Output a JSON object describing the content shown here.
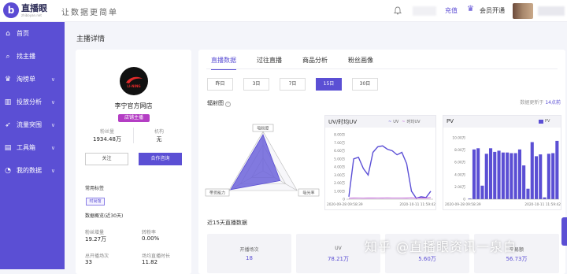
{
  "brand": {
    "logo_letter": "b",
    "name": "直播眼",
    "sub": "zhiboyan.net",
    "slogan": "让数据更简单"
  },
  "topbar": {
    "recharge": "充值",
    "member": "会员开通"
  },
  "sidebar": {
    "items": [
      {
        "label": "首页",
        "icon": "home-icon",
        "glyph": "⌂",
        "arrow": ""
      },
      {
        "label": "找主播",
        "icon": "search-icon",
        "glyph": "⌕",
        "arrow": ""
      },
      {
        "label": "淘榜单",
        "icon": "trophy-icon",
        "glyph": "♛",
        "arrow": "∨"
      },
      {
        "label": "投放分析",
        "icon": "bar-chart-icon",
        "glyph": "▥",
        "arrow": "∨"
      },
      {
        "label": "流量突围",
        "icon": "rocket-icon",
        "glyph": "➶",
        "arrow": "∨"
      },
      {
        "label": "工具箱",
        "icon": "toolbox-icon",
        "glyph": "▤",
        "arrow": "∨"
      },
      {
        "label": "我的数据",
        "icon": "pie-icon",
        "glyph": "◔",
        "arrow": "∨"
      }
    ]
  },
  "page_title": "主播详情",
  "profile": {
    "logo_text": "LI-NING",
    "name": "李宁官方网店",
    "tag": "店铺主播",
    "fans_label": "粉丝量",
    "fans_value": "1934.48万",
    "org_label": "机构",
    "org_value": "无",
    "follow": "关注",
    "consult": "合作咨询",
    "common_tags_title": "常用标签",
    "time_tag": "时尚馆",
    "overview_title": "数据概览(近30天)",
    "overview": [
      {
        "label": "粉丝增量",
        "value": "19.27万"
      },
      {
        "label": "转粉率",
        "value": "0.00%"
      },
      {
        "label": "总开播场次",
        "value": "33"
      },
      {
        "label": "场均直播时长",
        "value": "11.82"
      }
    ]
  },
  "tabs": [
    "直播数据",
    "过往直播",
    "商品分析",
    "粉丝画像"
  ],
  "ranges": [
    "昨日",
    "3日",
    "7日",
    "15日",
    "30日"
  ],
  "radar": {
    "title": "辐射图",
    "help": "?",
    "labels": [
      "带货能力",
      "吸光率"
    ],
    "top_label": "吸粉度"
  },
  "update": {
    "prefix": "数据更新于",
    "value": "14点前"
  },
  "uv_chart": {
    "title": "UV/时均UV",
    "legend": [
      "UV",
      "时均UV"
    ],
    "ticks": [
      "8.00万",
      "7.00万",
      "6.00万",
      "5.00万",
      "4.00万",
      "3.00万",
      "2.00万",
      "1.00万",
      "0"
    ],
    "x_start": "2020-09-28 09:58:39",
    "x_end": "2020-10-11 11:59:42"
  },
  "pv_chart": {
    "title": "PV",
    "legend": [
      "PV"
    ],
    "ticks": [
      "10.00万",
      "8.00万",
      "6.00万",
      "4.00万",
      "2.00万",
      "0"
    ],
    "x_start": "2020-09-28 09:58:39",
    "x_end": "2020-10-11 11:59:42"
  },
  "recent_title": "近15天直播数据",
  "summary": [
    {
      "label": "开播场次",
      "value": "18"
    },
    {
      "label": "UV",
      "value": "78.21万"
    },
    {
      "label": "",
      "value": "5.60万"
    },
    {
      "label": "交易额",
      "value": "56.73万"
    }
  ],
  "watermark": "知乎 @直播眼资讯一泉白",
  "chart_data": [
    {
      "type": "radar",
      "title": "辐射图",
      "axes": [
        "吸粉度",
        "带货能力",
        "吸光率"
      ],
      "values": [
        0.92,
        0.95,
        0.5
      ],
      "ylim": [
        0,
        1
      ]
    },
    {
      "type": "line",
      "title": "UV/时均UV",
      "ylim": [
        0,
        80000
      ],
      "series": [
        {
          "name": "UV",
          "values": [
            3000,
            50000,
            52000,
            38000,
            30000,
            58000,
            65000,
            66000,
            62000,
            60000,
            55000,
            58000,
            44000,
            10000,
            1200,
            3000,
            2000,
            10000
          ]
        },
        {
          "name": "时均UV",
          "values": [
            1200,
            1500,
            1400,
            1300,
            1500,
            1600,
            1400,
            1500,
            1700,
            1600,
            1600,
            1600,
            1500,
            1800,
            1400,
            1600,
            1500,
            2000
          ]
        }
      ]
    },
    {
      "type": "bar",
      "title": "PV",
      "ylim": [
        0,
        100000
      ],
      "series": [
        {
          "name": "PV",
          "values": [
            1000,
            81000,
            83000,
            22000,
            74000,
            83000,
            77000,
            79000,
            76000,
            76000,
            75000,
            75000,
            81000,
            55000,
            17000,
            93000,
            70000,
            73000,
            3000,
            74000,
            75000,
            95000
          ]
        }
      ]
    }
  ],
  "colors": {
    "primary": "#5b4fd4",
    "uv_line": "#5c50d6",
    "avg_line": "#c05ad8",
    "tag": "#b43ec4"
  }
}
